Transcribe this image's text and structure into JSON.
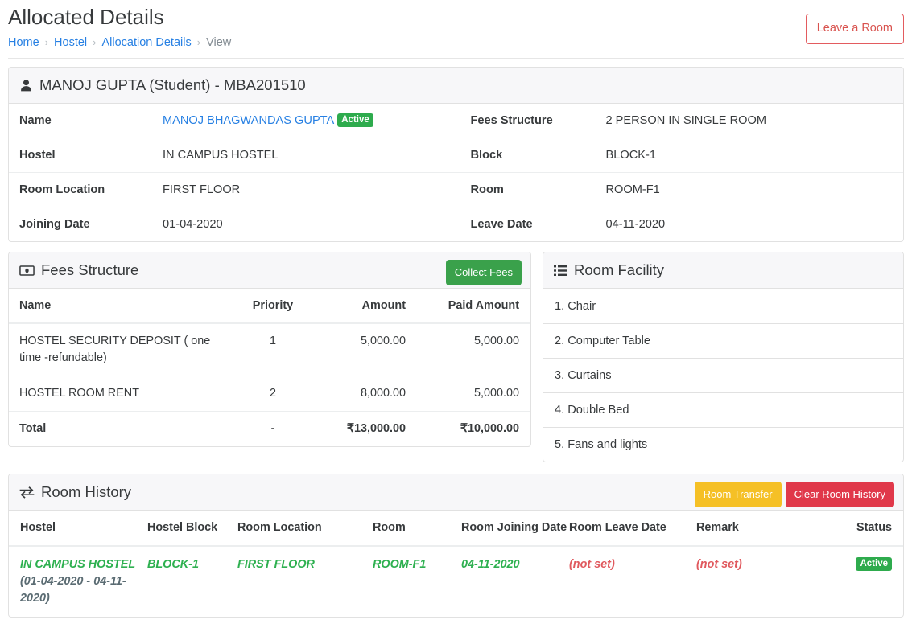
{
  "header": {
    "title": "Allocated Details",
    "breadcrumb": [
      {
        "label": "Home",
        "link": true
      },
      {
        "label": "Hostel",
        "link": true
      },
      {
        "label": "Allocation Details",
        "link": true
      },
      {
        "label": "View",
        "link": false
      }
    ],
    "separator": "›",
    "leave_room_button": "Leave a Room"
  },
  "student_card": {
    "icon": "user-icon",
    "title": "MANOJ GUPTA (Student) - MBA201510",
    "rows": [
      {
        "label_left": "Name",
        "value_left": "MANOJ BHAGWANDAS GUPTA",
        "value_left_is_link": true,
        "badge_left": "Active",
        "label_right": "Fees Structure",
        "value_right": "2 PERSON IN SINGLE ROOM"
      },
      {
        "label_left": "Hostel",
        "value_left": "IN CAMPUS HOSTEL",
        "value_left_is_link": false,
        "badge_left": "",
        "label_right": "Block",
        "value_right": "BLOCK-1"
      },
      {
        "label_left": "Room Location",
        "value_left": "FIRST FLOOR",
        "value_left_is_link": false,
        "badge_left": "",
        "label_right": "Room",
        "value_right": "ROOM-F1"
      },
      {
        "label_left": "Joining Date",
        "value_left": "01-04-2020",
        "value_left_is_link": false,
        "badge_left": "",
        "label_right": "Leave Date",
        "value_right": "04-11-2020"
      }
    ]
  },
  "fees_structure": {
    "icon": "money-bill-icon",
    "title": "Fees Structure",
    "collect_fees_button": "Collect Fees",
    "columns": [
      "Name",
      "Priority",
      "Amount",
      "Paid Amount"
    ],
    "rows": [
      {
        "name": "HOSTEL SECURITY DEPOSIT ( one time -refundable)",
        "priority": "1",
        "amount": "5,000.00",
        "paid_amount": "5,000.00"
      },
      {
        "name": "HOSTEL ROOM RENT",
        "priority": "2",
        "amount": "8,000.00",
        "paid_amount": "5,000.00"
      }
    ],
    "total": {
      "name": "Total",
      "priority": "-",
      "amount": "₹13,000.00",
      "paid_amount": "₹10,000.00"
    }
  },
  "room_facility": {
    "icon": "list-icon",
    "title": "Room Facility",
    "items": [
      "1. Chair",
      "2. Computer Table",
      "3. Curtains",
      "4. Double Bed",
      "5. Fans and lights"
    ]
  },
  "room_history": {
    "icon": "exchange-icon",
    "title": "Room History",
    "room_transfer_button": "Room Transfer",
    "clear_history_button": "Clear Room History",
    "columns": [
      "Hostel",
      "Hostel Block",
      "Room Location",
      "Room",
      "Room Joining Date",
      "Room Leave Date",
      "Remark",
      "Status"
    ],
    "rows": [
      {
        "hostel": "IN CAMPUS HOSTEL",
        "hostel_dates": "(01-04-2020 - 04-11-2020)",
        "hostel_block": "BLOCK-1",
        "room_location": "FIRST FLOOR",
        "room": "ROOM-F1",
        "room_joining_date": "04-11-2020",
        "room_leave_date": "(not set)",
        "remark": "(not set)",
        "status": "Active"
      }
    ]
  },
  "colors": {
    "link": "#2780e3",
    "danger": "#d9534f",
    "success": "#2eab4d",
    "warning": "#f5c026",
    "green_text": "#2eb050",
    "slate_text": "#5a6b72",
    "red_text": "#e0595e"
  }
}
